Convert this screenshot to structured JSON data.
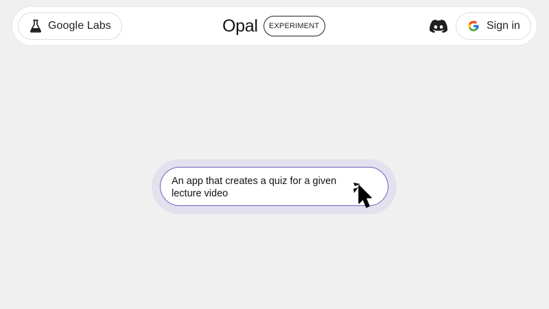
{
  "header": {
    "labs_button": {
      "label": "Google Labs",
      "icon": "flask-icon"
    },
    "brand": {
      "title": "Opal",
      "badge": "EXPERIMENT"
    },
    "discord": {
      "icon": "discord-icon"
    },
    "signin_button": {
      "label": "Sign in",
      "icon": "google-g-icon"
    }
  },
  "prompt": {
    "text": "An app that creates a quiz for a given lecture video"
  },
  "colors": {
    "background": "#f0f0f0",
    "accent_border": "#6a5fc1",
    "halo": "#e3e1ee"
  }
}
